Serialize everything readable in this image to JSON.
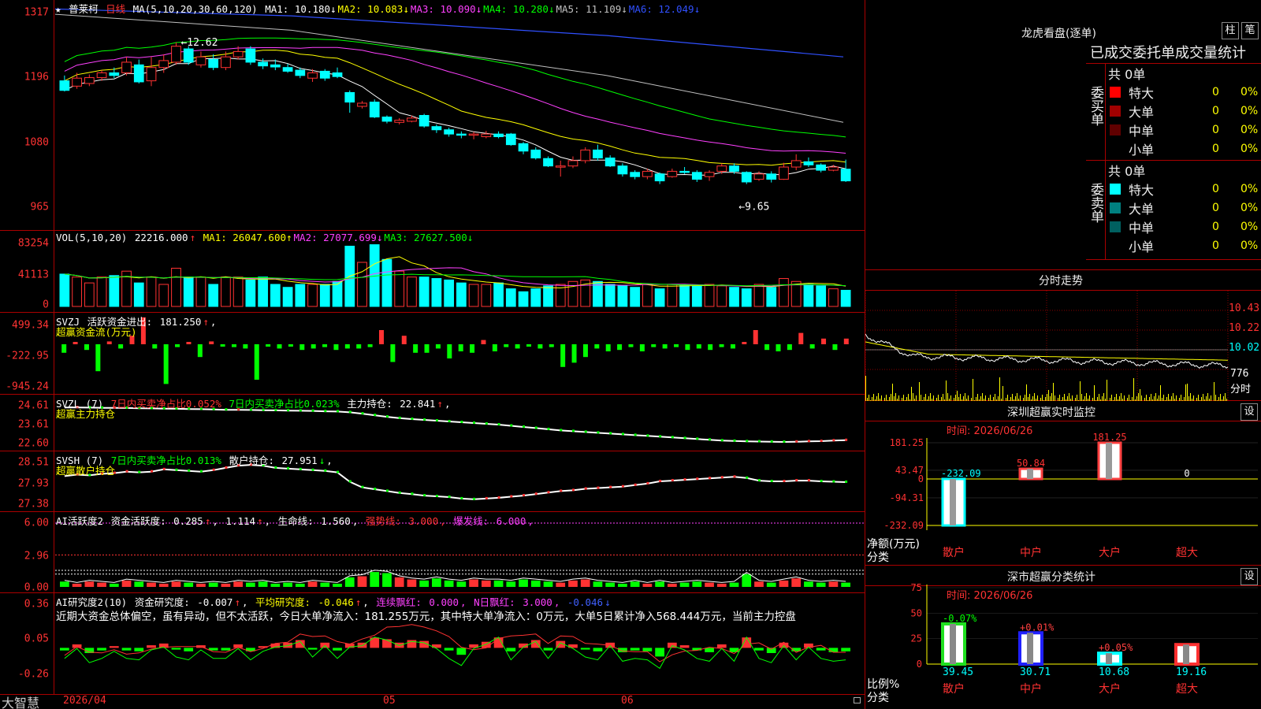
{
  "stock": {
    "name": "普莱柯",
    "period": "日线",
    "ma_label": "MA(5,10,20,30,60,120)",
    "ma": [
      {
        "label": "MA1:",
        "value": "10.180",
        "color": "#ffffff"
      },
      {
        "label": "MA2:",
        "value": "10.083",
        "color": "#ffff00"
      },
      {
        "label": "MA3:",
        "value": "10.090",
        "color": "#ff40ff"
      },
      {
        "label": "MA4:",
        "value": "10.280",
        "color": "#00ff00"
      },
      {
        "label": "MA5:",
        "value": "11.109",
        "color": "#c0c0c0"
      },
      {
        "label": "MA6:",
        "value": "12.049",
        "color": "#3050ff"
      }
    ],
    "price_axis": [
      "1317",
      "1196",
      "1080",
      "965"
    ],
    "price_range": [
      9.2,
      13.3
    ],
    "high_mark": "12.62",
    "low_mark": "9.65",
    "candles": [
      [
        11.9,
        11.72,
        12.0,
        11.7
      ],
      [
        11.8,
        11.95,
        12.05,
        11.75
      ],
      [
        11.85,
        11.96,
        12.02,
        11.8
      ],
      [
        11.96,
        12.05,
        12.1,
        11.9
      ],
      [
        12.05,
        12.0,
        12.15,
        11.95
      ],
      [
        12.05,
        12.25,
        12.35,
        12.0
      ],
      [
        12.2,
        11.88,
        12.3,
        11.85
      ],
      [
        11.9,
        12.15,
        12.35,
        11.8
      ],
      [
        12.15,
        12.28,
        12.4,
        12.05
      ],
      [
        12.25,
        12.55,
        12.62,
        12.2
      ],
      [
        12.5,
        12.25,
        12.55,
        12.2
      ],
      [
        12.2,
        12.35,
        12.45,
        12.15
      ],
      [
        12.3,
        12.15,
        12.4,
        12.1
      ],
      [
        12.15,
        12.35,
        12.45,
        12.1
      ],
      [
        12.35,
        12.45,
        12.55,
        12.3
      ],
      [
        12.5,
        12.25,
        12.55,
        12.2
      ],
      [
        12.25,
        12.18,
        12.32,
        12.12
      ],
      [
        12.2,
        12.16,
        12.3,
        12.1
      ],
      [
        12.15,
        12.08,
        12.22,
        12.05
      ],
      [
        12.1,
        12.0,
        12.15,
        11.95
      ],
      [
        11.95,
        12.05,
        12.12,
        11.88
      ],
      [
        12.08,
        11.95,
        12.12,
        11.9
      ],
      [
        12.05,
        11.98,
        12.15,
        11.95
      ],
      [
        11.68,
        11.5,
        11.72,
        11.3
      ],
      [
        11.42,
        11.48,
        11.52,
        11.38
      ],
      [
        11.5,
        11.22,
        11.55,
        11.2
      ],
      [
        11.22,
        11.14,
        11.25,
        11.1
      ],
      [
        11.12,
        11.16,
        11.2,
        11.08
      ],
      [
        11.14,
        11.2,
        11.25,
        11.12
      ],
      [
        11.25,
        11.05,
        11.28,
        11.02
      ],
      [
        11.04,
        10.98,
        11.08,
        10.92
      ],
      [
        10.98,
        10.9,
        11.02,
        10.85
      ],
      [
        10.9,
        10.88,
        10.95,
        10.82
      ],
      [
        10.88,
        10.9,
        10.94,
        10.8
      ],
      [
        10.85,
        10.9,
        10.96,
        10.82
      ],
      [
        10.9,
        10.85,
        10.95,
        10.82
      ],
      [
        10.9,
        10.7,
        10.92,
        10.68
      ],
      [
        10.72,
        10.58,
        10.75,
        10.52
      ],
      [
        10.6,
        10.45,
        10.65,
        10.42
      ],
      [
        10.44,
        10.3,
        10.48,
        10.28
      ],
      [
        10.3,
        10.3,
        10.4,
        10.1
      ],
      [
        10.3,
        10.4,
        10.48,
        10.26
      ],
      [
        10.4,
        10.6,
        10.65,
        10.35
      ],
      [
        10.6,
        10.45,
        10.7,
        10.4
      ],
      [
        10.45,
        10.3,
        10.5,
        10.28
      ],
      [
        10.3,
        10.15,
        10.35,
        10.1
      ],
      [
        10.18,
        10.1,
        10.22,
        10.05
      ],
      [
        10.1,
        10.2,
        10.25,
        10.05
      ],
      [
        10.15,
        10.02,
        10.18,
        9.96
      ],
      [
        10.1,
        10.2,
        10.25,
        10.08
      ],
      [
        10.2,
        10.18,
        10.28,
        10.15
      ],
      [
        10.18,
        10.05,
        10.22,
        10.0
      ],
      [
        10.1,
        10.18,
        10.22,
        10.02
      ],
      [
        10.2,
        10.3,
        10.35,
        10.15
      ],
      [
        10.3,
        10.2,
        10.35,
        10.15
      ],
      [
        10.18,
        10.0,
        10.2,
        9.96
      ],
      [
        10.05,
        10.15,
        10.2,
        10.02
      ],
      [
        10.15,
        10.05,
        10.2,
        9.99
      ],
      [
        10.05,
        10.28,
        10.36,
        10.04
      ],
      [
        10.28,
        10.4,
        10.52,
        10.22
      ],
      [
        10.38,
        10.32,
        10.46,
        10.28
      ],
      [
        10.32,
        10.22,
        10.35,
        10.18
      ],
      [
        10.22,
        10.28,
        10.32,
        10.2
      ],
      [
        10.24,
        10.02,
        10.42,
        10.0
      ]
    ],
    "vol_label": "VOL(5,10,20)",
    "vol_value": "22216.000",
    "vol_ma": [
      {
        "label": "MA1:",
        "value": "26047.600",
        "color": "#ffff00"
      },
      {
        "label": "MA2:",
        "value": "27077.699",
        "color": "#ff40ff"
      },
      {
        "label": "MA3:",
        "value": "27627.500",
        "color": "#00ff00"
      }
    ],
    "vol_axis": [
      "83254",
      "41113",
      "0"
    ],
    "volumes": [
      44,
      40,
      32,
      40,
      42,
      48,
      32,
      40,
      30,
      52,
      40,
      40,
      30,
      40,
      40,
      36,
      40,
      30,
      26,
      30,
      30,
      30,
      34,
      82,
      60,
      84,
      64,
      48,
      40,
      40,
      38,
      36,
      32,
      30,
      30,
      32,
      24,
      20,
      24,
      28,
      30,
      34,
      36,
      34,
      30,
      28,
      26,
      30,
      24,
      30,
      30,
      28,
      30,
      28,
      26,
      24,
      30,
      26,
      38,
      34,
      30,
      28,
      24,
      22
    ],
    "svzj_header": [
      "SVZJ",
      "活跃资金进出:",
      "181.250"
    ],
    "svzj_sub": "超赢资金流(万元)",
    "svzj_axis": [
      "499.34",
      "-222.95",
      "-945.24"
    ],
    "svzj_values": [
      -120,
      20,
      -80,
      -380,
      40,
      -60,
      120,
      380,
      -60,
      -560,
      -40,
      20,
      -180,
      40,
      -20,
      -40,
      -60,
      -500,
      -30,
      -60,
      -20,
      -80,
      -60,
      -40,
      -80,
      -60,
      -60,
      -40,
      200,
      -250,
      120,
      -120,
      -120,
      -60,
      -200,
      -100,
      -120,
      60,
      -100,
      -40,
      -60,
      -30,
      -60,
      -40,
      -320,
      -260,
      -180,
      -60,
      -100,
      -80,
      -40,
      -100,
      -40,
      -60,
      -40,
      -80,
      -60,
      -80,
      -40,
      -60,
      30,
      200,
      -80,
      -100,
      -80,
      160,
      -60,
      80,
      -80,
      80
    ],
    "svzl_header": [
      "SVZL (7)",
      "7日内买卖净占比0.052%",
      "7日内买卖净占比0.023%",
      "主力持仓:",
      "22.841"
    ],
    "svzl_sub": "超赢主力持仓",
    "svzl_axis": [
      "24.61",
      "23.61",
      "22.60"
    ],
    "svzl_values": [
      24.4,
      24.4,
      24.39,
      24.38,
      24.38,
      24.37,
      24.36,
      24.35,
      24.34,
      24.33,
      24.32,
      24.31,
      24.3,
      24.28,
      24.28,
      24.27,
      24.26,
      24.25,
      24.24,
      24.23,
      24.22,
      24.2,
      24.19,
      24.15,
      24.08,
      24.0,
      23.92,
      23.85,
      23.8,
      23.76,
      23.72,
      23.68,
      23.64,
      23.6,
      23.56,
      23.52,
      23.46,
      23.4,
      23.34,
      23.28,
      23.22,
      23.18,
      23.14,
      23.1,
      23.06,
      23.02,
      22.98,
      22.94,
      22.9,
      22.86,
      22.82,
      22.78,
      22.74,
      22.7,
      22.68,
      22.66,
      22.65,
      22.64,
      22.63,
      22.64,
      22.66,
      22.67,
      22.7,
      22.72
    ],
    "svsh_header": [
      "SVSH (7)",
      "7日内买卖净占比0.013%",
      "散户持仓:",
      "27.951"
    ],
    "svsh_sub": "超赢散户持仓",
    "svsh_axis": [
      "28.51",
      "27.93",
      "27.38"
    ],
    "svsh_values": [
      28.1,
      28.14,
      28.12,
      28.16,
      28.18,
      28.22,
      28.2,
      28.22,
      28.28,
      28.26,
      28.24,
      28.22,
      28.26,
      28.32,
      28.38,
      28.4,
      28.38,
      28.32,
      28.3,
      28.28,
      28.26,
      28.24,
      28.2,
      27.95,
      27.8,
      27.75,
      27.7,
      27.65,
      27.62,
      27.58,
      27.56,
      27.54,
      27.5,
      27.48,
      27.5,
      27.52,
      27.55,
      27.58,
      27.62,
      27.66,
      27.7,
      27.72,
      27.76,
      27.78,
      27.8,
      27.82,
      27.86,
      27.9,
      27.96,
      27.98,
      28.0,
      28.02,
      28.04,
      28.06,
      28.08,
      28.05,
      27.98,
      27.96,
      27.96,
      27.98,
      27.98,
      27.96,
      27.95,
      27.94
    ],
    "ai_header": [
      "AI活跃度2",
      "资金活跃度:",
      "0.285",
      "1.114",
      "生命线:",
      "1.560",
      "强势线:",
      "3.000",
      "爆发线:",
      "6.000"
    ],
    "ai_axis": [
      "6.00",
      "2.96",
      "0.00"
    ],
    "air_header": [
      "AI研究度2(10)",
      "资金研究度:",
      "-0.007",
      "平均研究度:",
      "-0.046",
      "连续飘红:",
      "0.000",
      "N日飘红:",
      "3.000",
      "-0.046"
    ],
    "air_axis": [
      "0.36",
      "0.05",
      "-0.26"
    ],
    "air_note": "近期大资金总体偏空，虽有异动，但不太活跃，今日大单净流入：181.255万元，其中特大单净流入：0万元，大单5日累计净入568.444万元，当前主力控盘",
    "air_values": [
      -0.03,
      0.04,
      -0.06,
      -0.03,
      0.02,
      -0.03,
      -0.04,
      0.03,
      0.05,
      -0.02,
      -0.04,
      0.03,
      -0.03,
      -0.03,
      0.04,
      -0.04,
      0.02,
      0.05,
      0.06,
      0.09,
      -0.02,
      0.06,
      -0.03,
      0.05,
      0.06,
      0.12,
      0.1,
      0.06,
      0.09,
      0.08,
      0.04,
      -0.03,
      -0.08,
      0.04,
      0.07,
      0.12,
      -0.04,
      0.05,
      0.09,
      -0.03,
      0.08,
      0.04,
      -0.02,
      -0.04,
      0.06,
      -0.05,
      -0.03,
      -0.04,
      -0.1,
      0.06,
      0.03,
      -0.03,
      -0.05,
      0.04,
      -0.05,
      0.12,
      -0.03,
      -0.06,
      0.06,
      -0.04,
      0.05,
      -0.03,
      -0.05,
      -0.04
    ]
  },
  "time_axis": [
    "2026/04",
    "05",
    "06"
  ],
  "brand": "大智慧",
  "right": {
    "lh_title": "龙虎看盘(逐单)",
    "btn_bar": "柱",
    "btn_pen": "笔",
    "tabs_text": "已成交委托单成交量统计",
    "buy_label": "委买单",
    "sell_label": "委卖单",
    "buy_total": "共 0单",
    "sell_total": "共 0单",
    "buy_rows": [
      {
        "label": "特大",
        "count": "0",
        "pct": "0%",
        "color": "#ff0000"
      },
      {
        "label": "大单",
        "count": "0",
        "pct": "0%",
        "color": "#a00000"
      },
      {
        "label": "中单",
        "count": "0",
        "pct": "0%",
        "color": "#600000"
      },
      {
        "label": "小单",
        "count": "0",
        "pct": "0%",
        "color": "#000000"
      }
    ],
    "sell_rows": [
      {
        "label": "特大",
        "count": "0",
        "pct": "0%",
        "color": "#00ffff"
      },
      {
        "label": "大单",
        "count": "0",
        "pct": "0%",
        "color": "#008080"
      },
      {
        "label": "中单",
        "count": "0",
        "pct": "0%",
        "color": "#006060"
      },
      {
        "label": "小单",
        "count": "0",
        "pct": "0%",
        "color": "#000000"
      }
    ],
    "fs_title": "分时走势",
    "fs_axis": [
      "10.43",
      "10.22",
      "10.02",
      "776"
    ],
    "fs_unit": "分时",
    "sz_title": "深圳超赢实时监控",
    "sz_btn": "设",
    "sz_time": "时间: 2026/06/26",
    "sz_axis": [
      "181.25",
      "43.47",
      "0",
      "-94.31",
      "-232.09"
    ],
    "sz_ylabel": "净额(万元)",
    "sz_xlabel": "分类",
    "sz_bars": [
      {
        "label": "散户",
        "value": -232.09,
        "text": "-232.09",
        "color": "#00ffff"
      },
      {
        "label": "中户",
        "value": 50.84,
        "text": "50.84",
        "color": "#ff4040"
      },
      {
        "label": "大户",
        "value": 181.25,
        "text": "181.25",
        "color": "#ff4040"
      },
      {
        "label": "超大",
        "value": 0,
        "text": "0",
        "color": "#ffffff"
      }
    ],
    "ss_title": "深市超赢分类统计",
    "ss_btn": "设",
    "ss_time": "时间: 2026/06/26",
    "ss_axis": [
      "75",
      "50",
      "25",
      "0"
    ],
    "ss_ylabel": "比例%",
    "ss_xlabel": "分类",
    "ss_bars": [
      {
        "label": "散户",
        "value": 39.45,
        "text": "39.45",
        "delta": "-0.07%",
        "color": "#20e020",
        "dcolor": "#00ff00"
      },
      {
        "label": "中户",
        "value": 30.71,
        "text": "30.71",
        "delta": "+0.01%",
        "color": "#2020ff",
        "dcolor": "#ff4040"
      },
      {
        "label": "大户",
        "value": 10.68,
        "text": "10.68",
        "delta": "+0.05%",
        "color": "#00ffff",
        "dcolor": "#ff4040"
      },
      {
        "label": "超大",
        "value": 19.16,
        "text": "19.16",
        "delta": "",
        "color": "#ff3030",
        "dcolor": "#ff4040"
      }
    ]
  }
}
